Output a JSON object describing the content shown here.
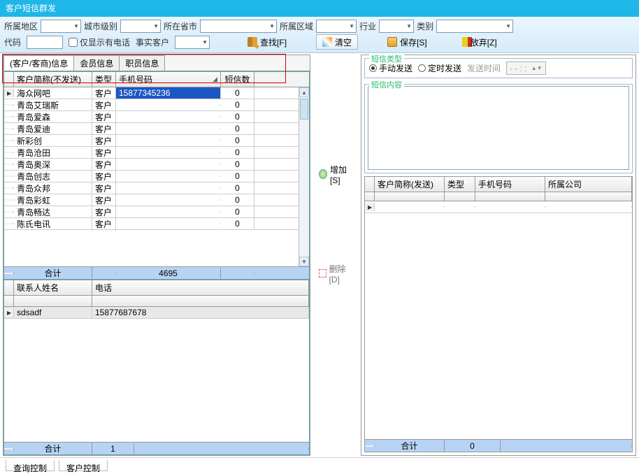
{
  "title": "客户短信群发",
  "filters": {
    "region_lbl": "所属地区",
    "citylvl_lbl": "城市级别",
    "province_lbl": "所在省市",
    "area_lbl": "所属区域",
    "industry_lbl": "行业",
    "category_lbl": "类别",
    "code_lbl": "代码",
    "only_phone_lbl": "仅显示有电话",
    "real_cust_lbl": "事实客户"
  },
  "toolbar": {
    "find": "查找[F]",
    "clear": "清空",
    "save": "保存[S]",
    "discard": "放弃[Z]"
  },
  "tabs": {
    "t1": "(客户/客商)信息",
    "t2": "会员信息",
    "t3": "职员信息"
  },
  "grid1": {
    "h_name": "客户简称(不发送)",
    "h_type": "类型",
    "h_phone": "手机号码",
    "h_cnt": "短信数",
    "rows": [
      {
        "name": "海众网吧",
        "type": "客户",
        "phone": "15877345236",
        "cnt": "0"
      },
      {
        "name": "青岛艾瑞斯",
        "type": "客户",
        "phone": "",
        "cnt": "0"
      },
      {
        "name": "青岛爱森",
        "type": "客户",
        "phone": "",
        "cnt": "0"
      },
      {
        "name": "青岛爱迪",
        "type": "客户",
        "phone": "",
        "cnt": "0"
      },
      {
        "name": "新彩创",
        "type": "客户",
        "phone": "",
        "cnt": "0"
      },
      {
        "name": "青岛沧田",
        "type": "客户",
        "phone": "",
        "cnt": "0"
      },
      {
        "name": "青岛奥深",
        "type": "客户",
        "phone": "",
        "cnt": "0"
      },
      {
        "name": "青岛创志",
        "type": "客户",
        "phone": "",
        "cnt": "0"
      },
      {
        "name": "青岛众邦",
        "type": "客户",
        "phone": "",
        "cnt": "0"
      },
      {
        "name": "青岛彩虹",
        "type": "客户",
        "phone": "",
        "cnt": "0"
      },
      {
        "name": "青岛畅达",
        "type": "客户",
        "phone": "",
        "cnt": "0"
      },
      {
        "name": "陈氏电讯",
        "type": "客户",
        "phone": "",
        "cnt": "0"
      }
    ],
    "foot_lbl": "合计",
    "foot_total": "4695"
  },
  "grid2": {
    "h_contact": "联系人姓名",
    "h_tel": "电话",
    "rows": [
      {
        "contact": "sdsadf",
        "tel": "15877687678"
      }
    ],
    "foot_lbl": "合计",
    "foot_total": "1"
  },
  "mid": {
    "add": "增加[S]",
    "del": "删除[D]"
  },
  "sms": {
    "type_lbl": "短信类型",
    "manual": "手动发送",
    "timed": "定时发送",
    "time_lbl": "发送时间",
    "dt_placeholder": "-   -       :   :",
    "content_lbl": "短信内容"
  },
  "grid3": {
    "h_name": "客户简称(发送)",
    "h_type": "类型",
    "h_phone": "手机号码",
    "h_comp": "所属公司",
    "foot_lbl": "合计",
    "foot_total": "0"
  },
  "bottom": {
    "t1": "查询控制",
    "t2": "客户控制"
  }
}
